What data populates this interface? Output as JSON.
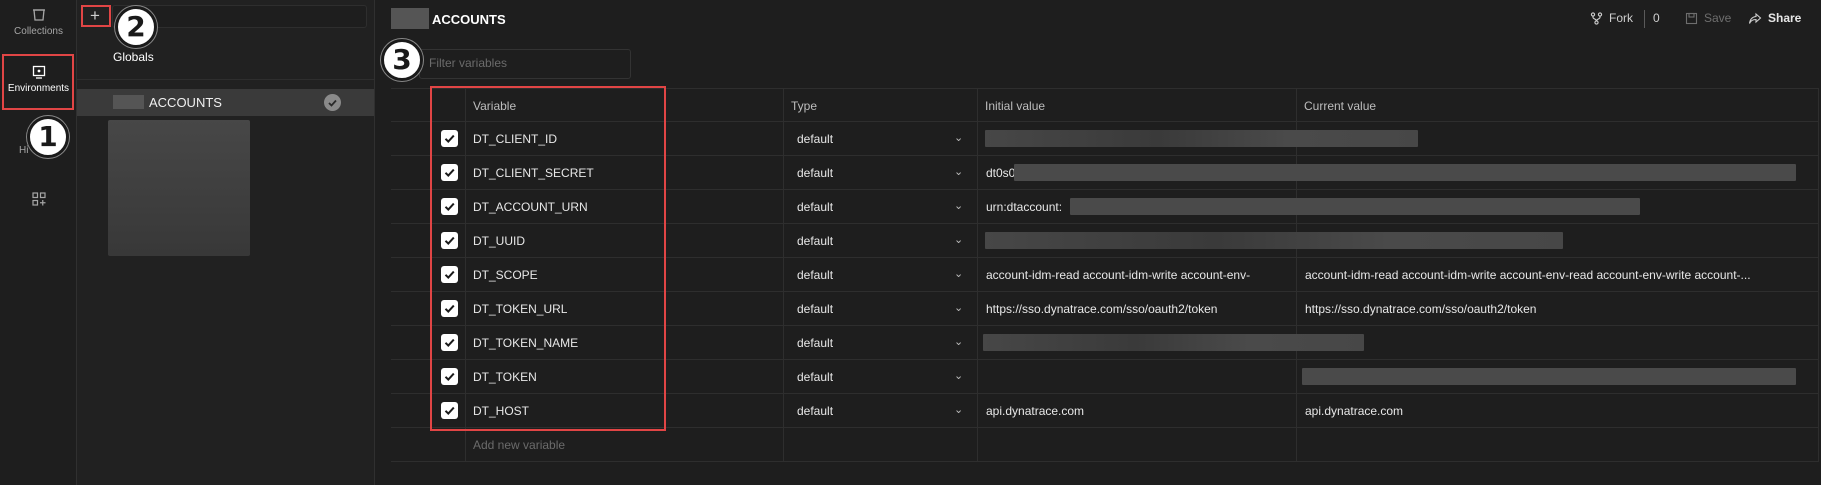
{
  "rail": {
    "collections_label": "Collections",
    "environments_label": "Environments",
    "history_label": "Hi"
  },
  "env_panel": {
    "globals_label": "Globals",
    "environments": [
      {
        "name": "ACCOUNTS",
        "active": true
      }
    ]
  },
  "header": {
    "title": "ACCOUNTS",
    "fork_label": "Fork",
    "fork_count": "0",
    "save_label": "Save",
    "share_label": "Share"
  },
  "filter": {
    "placeholder": "Filter variables"
  },
  "table": {
    "columns": {
      "variable": "Variable",
      "type": "Type",
      "initial": "Initial value",
      "current": "Current value"
    },
    "rows": [
      {
        "variable": "DT_CLIENT_ID",
        "type": "default",
        "initial": "",
        "current": ""
      },
      {
        "variable": "DT_CLIENT_SECRET",
        "type": "default",
        "initial": "dt0s0",
        "current": ""
      },
      {
        "variable": "DT_ACCOUNT_URN",
        "type": "default",
        "initial": "urn:dtaccount:",
        "current": ""
      },
      {
        "variable": "DT_UUID",
        "type": "default",
        "initial": "",
        "current": ""
      },
      {
        "variable": "DT_SCOPE",
        "type": "default",
        "initial": "account-idm-read account-idm-write account-env-",
        "current": "account-idm-read account-idm-write account-env-read account-env-write account-..."
      },
      {
        "variable": "DT_TOKEN_URL",
        "type": "default",
        "initial": "https://sso.dynatrace.com/sso/oauth2/token",
        "current": "https://sso.dynatrace.com/sso/oauth2/token"
      },
      {
        "variable": "DT_TOKEN_NAME",
        "type": "default",
        "initial": "",
        "current": ""
      },
      {
        "variable": "DT_TOKEN",
        "type": "default",
        "initial": "",
        "current": ""
      },
      {
        "variable": "DT_HOST",
        "type": "default",
        "initial": "api.dynatrace.com",
        "current": "api.dynatrace.com"
      }
    ],
    "add_new_placeholder": "Add new variable"
  },
  "annotations": {
    "badge1": "1",
    "badge2": "2",
    "badge3": "3"
  },
  "colors": {
    "highlight": "#e14545",
    "background": "#1e1e1e"
  }
}
